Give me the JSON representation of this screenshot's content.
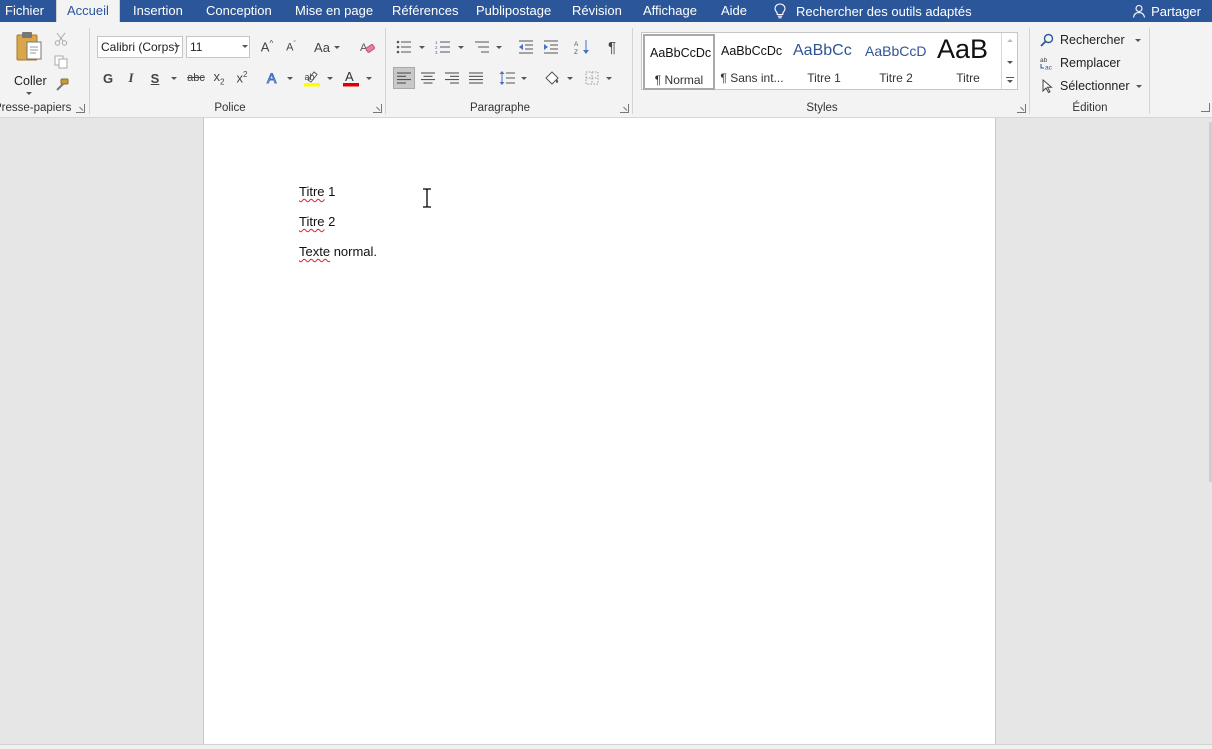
{
  "menu": {
    "tabs": [
      {
        "label": "Fichier"
      },
      {
        "label": "Accueil"
      },
      {
        "label": "Insertion"
      },
      {
        "label": "Conception"
      },
      {
        "label": "Mise en page"
      },
      {
        "label": "Références"
      },
      {
        "label": "Publipostage"
      },
      {
        "label": "Révision"
      },
      {
        "label": "Affichage"
      },
      {
        "label": "Aide"
      }
    ],
    "active_tab": "Accueil",
    "tell_me": "Rechercher des outils adaptés",
    "share": "Partager"
  },
  "ribbon": {
    "clipboard": {
      "paste_label": "Coller",
      "group_label": "Presse-papiers"
    },
    "font": {
      "font_name": "Calibri (Corps)",
      "font_size": "11",
      "group_label": "Police",
      "case_label": "Aa",
      "bold": "G",
      "italic": "I",
      "underline": "S",
      "strike": "abc"
    },
    "paragraph": {
      "group_label": "Paragraphe"
    },
    "styles": {
      "group_label": "Styles",
      "items": [
        {
          "sample": "AaBbCcDc",
          "name": "¶ Normal"
        },
        {
          "sample": "AaBbCcDc",
          "name": "¶ Sans int..."
        },
        {
          "sample": "AaBbCc",
          "name": "Titre 1"
        },
        {
          "sample": "AaBbCcD",
          "name": "Titre 2"
        },
        {
          "sample": "AaB",
          "name": "Titre"
        }
      ]
    },
    "editing": {
      "find": "Rechercher",
      "replace": "Remplacer",
      "select": "Sélectionner",
      "group_label": "Édition"
    }
  },
  "document": {
    "paragraphs": [
      {
        "text": "Titre 1",
        "misspelled": "Titre",
        "rest": " 1"
      },
      {
        "text": "Titre 2",
        "misspelled": "Titre",
        "rest": " 2"
      },
      {
        "text": "Texte normal.",
        "misspelled": "Texte",
        "rest": " normal."
      }
    ]
  },
  "colors": {
    "accent": "#2b579a",
    "ribbon_bg": "#f3f3f3",
    "canvas_bg": "#e6e6e6",
    "highlight_yellow": "#ffff00",
    "font_color_red": "#e00000"
  }
}
